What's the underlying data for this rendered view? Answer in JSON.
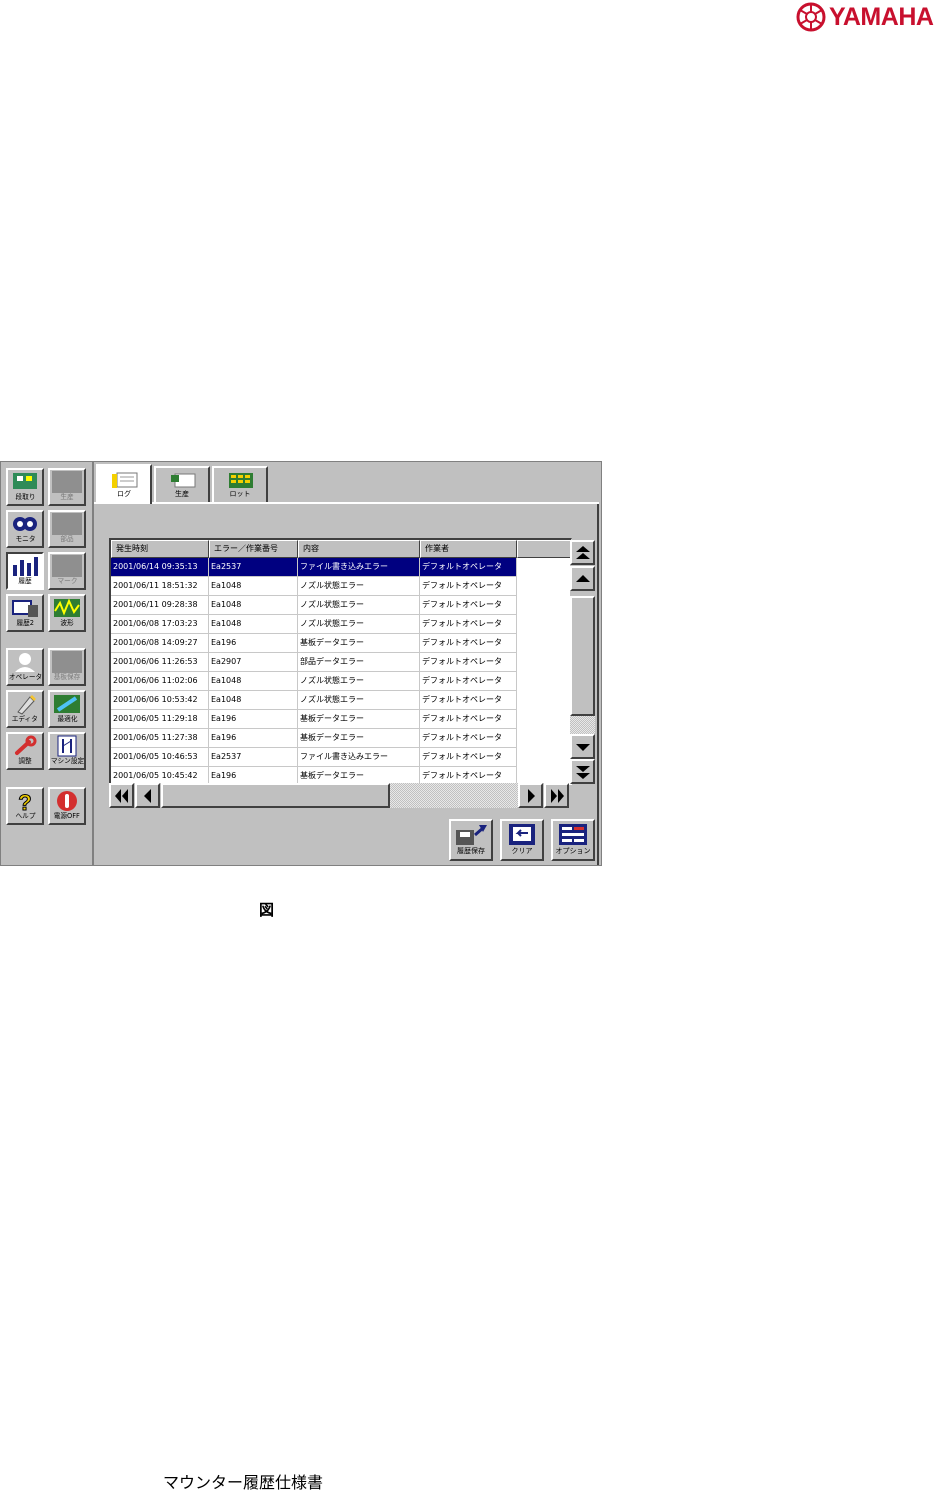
{
  "brand": {
    "name": "YAMAHA",
    "color": "#c8102e"
  },
  "left_panel": {
    "buttons": [
      {
        "label": "段取り",
        "icon": "setup-icon",
        "enabled": true
      },
      {
        "label": "生産",
        "icon": "production-icon",
        "enabled": false
      },
      {
        "label": "モニタ",
        "icon": "monitor-icon",
        "enabled": true
      },
      {
        "label": "部品",
        "icon": "parts-icon",
        "enabled": false
      },
      {
        "label": "履歴",
        "icon": "history-icon",
        "enabled": true,
        "active": true
      },
      {
        "label": "マーク",
        "icon": "mark-icon",
        "enabled": false
      },
      {
        "label": "履歴2",
        "icon": "history2-icon",
        "enabled": true
      },
      {
        "label": "波形",
        "icon": "waveform-icon",
        "enabled": true
      },
      {
        "label": "オペレータ",
        "icon": "operator-icon",
        "enabled": true
      },
      {
        "label": "基板保存",
        "icon": "board-save-icon",
        "enabled": false
      },
      {
        "label": "エディタ",
        "icon": "editor-icon",
        "enabled": true
      },
      {
        "label": "最適化",
        "icon": "optimize-icon",
        "enabled": true
      },
      {
        "label": "調整",
        "icon": "wrench-icon",
        "enabled": true
      },
      {
        "label": "マシン設定",
        "icon": "machine-settings-icon",
        "enabled": true
      },
      {
        "label": "ヘルプ",
        "icon": "help-icon",
        "enabled": true
      },
      {
        "label": "電源OFF",
        "icon": "power-icon",
        "enabled": true
      }
    ]
  },
  "tabs": [
    {
      "label": "ログ",
      "active": true
    },
    {
      "label": "生産",
      "active": false
    },
    {
      "label": "ロット",
      "active": false
    }
  ],
  "log_table": {
    "columns": [
      "発生時刻",
      "エラー／作業番号",
      "内容",
      "作業者"
    ],
    "selected_index": 0,
    "rows": [
      [
        "2001/06/14 09:35:13",
        "Ea2537",
        "ファイル書き込みエラー",
        "デフォルトオペレータ"
      ],
      [
        "2001/06/11 18:51:32",
        "Ea1048",
        "ノズル状態エラー",
        "デフォルトオペレータ"
      ],
      [
        "2001/06/11 09:28:38",
        "Ea1048",
        "ノズル状態エラー",
        "デフォルトオペレータ"
      ],
      [
        "2001/06/08 17:03:23",
        "Ea1048",
        "ノズル状態エラー",
        "デフォルトオペレータ"
      ],
      [
        "2001/06/08 14:09:27",
        "Ea196",
        "基板データエラー",
        "デフォルトオペレータ"
      ],
      [
        "2001/06/06 11:26:53",
        "Ea2907",
        "部品データエラー",
        "デフォルトオペレータ"
      ],
      [
        "2001/06/06 11:02:06",
        "Ea1048",
        "ノズル状態エラー",
        "デフォルトオペレータ"
      ],
      [
        "2001/06/06 10:53:42",
        "Ea1048",
        "ノズル状態エラー",
        "デフォルトオペレータ"
      ],
      [
        "2001/06/05 11:29:18",
        "Ea196",
        "基板データエラー",
        "デフォルトオペレータ"
      ],
      [
        "2001/06/05 11:27:38",
        "Ea196",
        "基板データエラー",
        "デフォルトオペレータ"
      ],
      [
        "2001/06/05 10:46:53",
        "Ea2537",
        "ファイル書き込みエラー",
        "デフォルトオペレータ"
      ],
      [
        "2001/06/05 10:45:42",
        "Ea196",
        "基板データエラー",
        "デフォルトオペレータ"
      ]
    ]
  },
  "actions": {
    "save_history": "履歴保存",
    "clear": "クリア",
    "options": "オプション"
  },
  "caption": "図",
  "footer": "マウンター履歴仕様書"
}
